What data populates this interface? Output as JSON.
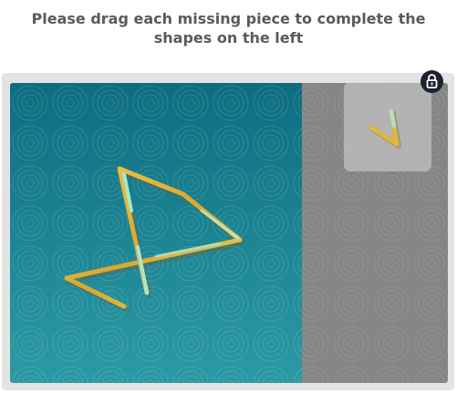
{
  "instruction": "Please drag each missing piece to complete the shapes on the left",
  "colors": {
    "canvas_teal": "#1a8696",
    "tray_gray": "#858585",
    "stroke_gold": "#e0b83a",
    "stroke_mint": "#9fe0c6",
    "lock_bg": "#1d2230"
  },
  "icons": {
    "lock": "lock-icon"
  }
}
